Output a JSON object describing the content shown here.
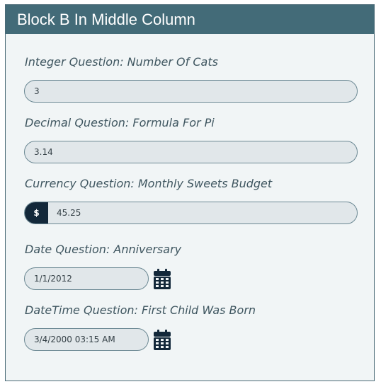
{
  "block": {
    "title": "Block B In Middle Column"
  },
  "questions": {
    "integer": {
      "label": "Integer Question: Number Of Cats",
      "value": "3"
    },
    "decimal": {
      "label": "Decimal Question: Formula For Pi",
      "value": "3.14"
    },
    "currency": {
      "label": "Currency Question: Monthly Sweets Budget",
      "symbol": "$",
      "value": "45.25"
    },
    "date": {
      "label": "Date Question: Anniversary",
      "value": "1/1/2012",
      "icon": "calendar-icon"
    },
    "datetime": {
      "label": "DateTime Question: First Child Was Born",
      "value": "3/4/2000 03:15 AM",
      "icon": "calendar-icon"
    }
  },
  "colors": {
    "header_bg": "#436b78",
    "panel_bg": "#f1f5f6",
    "input_bg": "#e1e7ea",
    "addon_bg": "#13283a",
    "label_text": "#3f5660"
  }
}
